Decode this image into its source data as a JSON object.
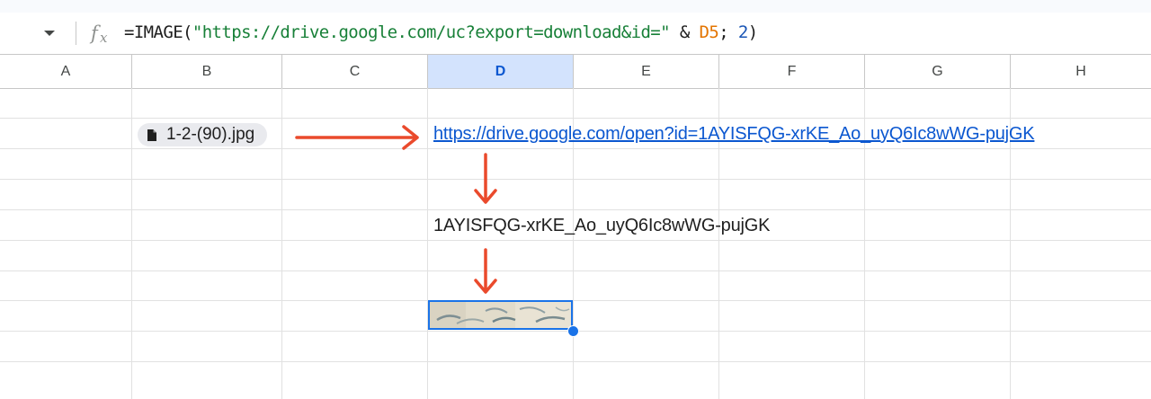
{
  "formula_bar": {
    "fx_icon": "fx-icon",
    "dropdown_icon": "caret-down-icon",
    "tokens": [
      {
        "text": "=IMAGE(",
        "kind": "plain"
      },
      {
        "text": "\"https://drive.google.com/uc?export=download&id=\"",
        "kind": "string"
      },
      {
        "text": " & ",
        "kind": "plain"
      },
      {
        "text": "D5",
        "kind": "ref"
      },
      {
        "text": "; ",
        "kind": "plain"
      },
      {
        "text": "2",
        "kind": "number"
      },
      {
        "text": ")",
        "kind": "plain"
      }
    ]
  },
  "columns": [
    {
      "label": "A",
      "selected": false
    },
    {
      "label": "B",
      "selected": false
    },
    {
      "label": "C",
      "selected": false
    },
    {
      "label": "D",
      "selected": true
    },
    {
      "label": "E",
      "selected": false
    },
    {
      "label": "F",
      "selected": false
    },
    {
      "label": "G",
      "selected": false
    },
    {
      "label": "H",
      "selected": false
    }
  ],
  "cells": {
    "file_chip": {
      "label": "1-2-(90).jpg",
      "icon": "file-icon"
    },
    "link": "https://drive.google.com/open?id=1AYISFQG-xrKE_Ao_uyQ6Ic8wWG-pujGK",
    "file_id": "1AYISFQG-xrKE_Ao_uyQ6Ic8wWG-pujGK",
    "image_thumbnail": "image-thumbnail"
  },
  "colors": {
    "accent": "#1a73e8",
    "arrow": "#ea4a2c",
    "selected_header": "#d3e3fd",
    "link": "#0b57d0",
    "string_token": "#188038",
    "ref_token": "#e37400",
    "number_token": "#1a55b5"
  }
}
